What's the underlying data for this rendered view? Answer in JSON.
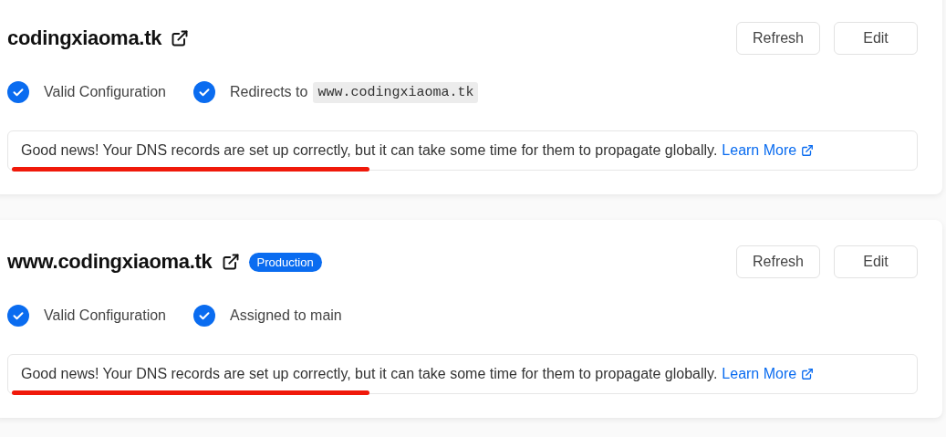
{
  "domains": [
    {
      "name": "codingxiaoma.tk",
      "buttons": [
        "Refresh",
        "Edit"
      ],
      "statuses": [
        {
          "label": "Valid Configuration"
        },
        {
          "label": "Redirects to",
          "value": "www.codingxiaoma.tk"
        }
      ],
      "notice": {
        "text": "Good news! Your DNS records are set up correctly, but it can take some time for them to propagate globally.",
        "link": "Learn More",
        "underlined": true
      }
    },
    {
      "name": "www.codingxiaoma.tk",
      "badge": "Production",
      "buttons": [
        "Refresh",
        "Edit"
      ],
      "statuses": [
        {
          "label": "Valid Configuration"
        },
        {
          "label": "Assigned to main"
        }
      ],
      "notice": {
        "text": "Good news! Your DNS records are set up correctly, but it can take some time for them to propagate globally.",
        "link": "Learn More",
        "underlined": true
      }
    }
  ]
}
